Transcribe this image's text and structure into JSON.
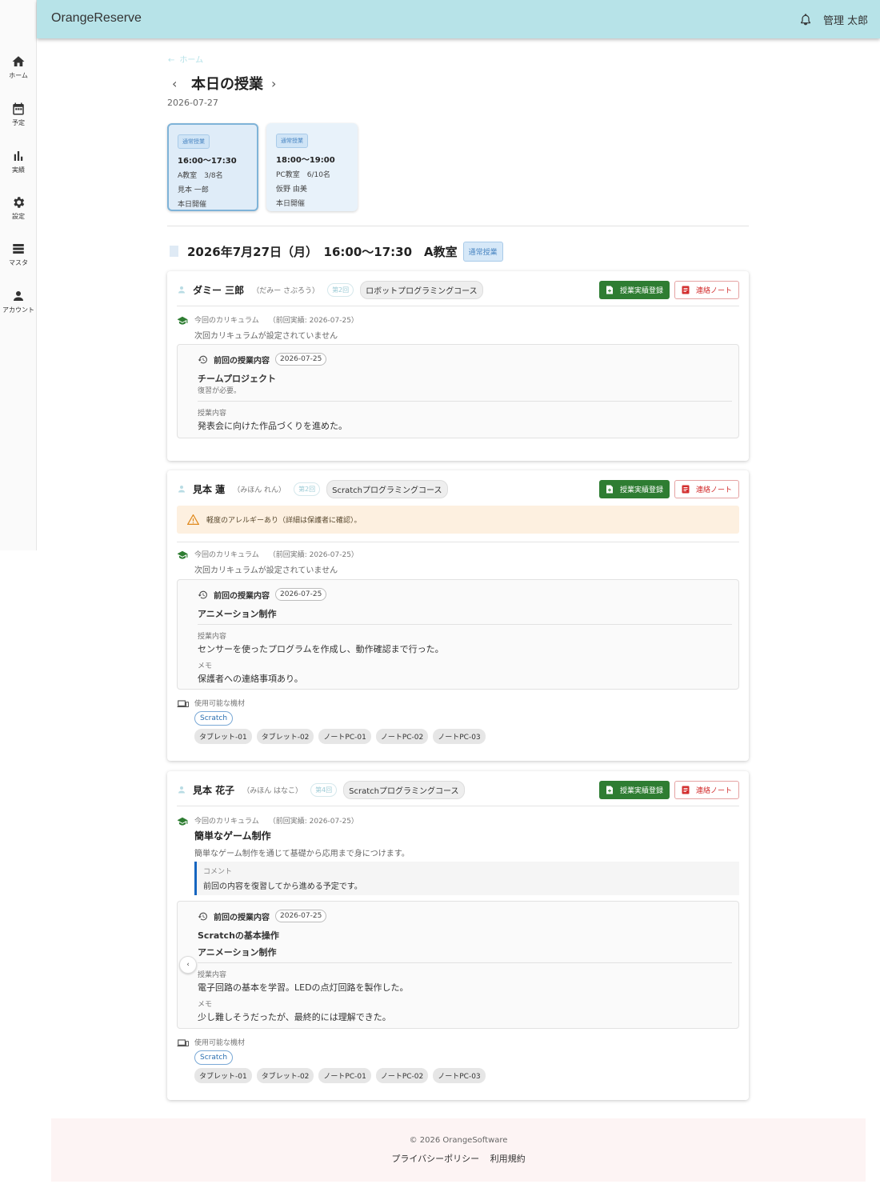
{
  "app": {
    "brand": "OrangeReserve",
    "user": "管理 太郎"
  },
  "sidebar": [
    {
      "label": "ホーム",
      "icon": "home-icon"
    },
    {
      "label": "予定",
      "icon": "calendar-icon"
    },
    {
      "label": "実績",
      "icon": "bar-chart-icon"
    },
    {
      "label": "設定",
      "icon": "gear-icon"
    },
    {
      "label": "マスタ",
      "icon": "list-icon"
    },
    {
      "label": "アカウント",
      "icon": "person-icon"
    }
  ],
  "page": {
    "breadcrumb": "ホーム",
    "title": "本日の授業",
    "date": "2026-07-27"
  },
  "class_cards": [
    {
      "tag": "通常授業",
      "time": "16:00〜17:30",
      "room_cap": "A教室　3/8名",
      "teacher": "見本 一郎",
      "status": "本日開催",
      "selected": true
    },
    {
      "tag": "通常授業",
      "time": "18:00〜19:00",
      "room_cap": "PC教室　6/10名",
      "teacher": "仮野 由美",
      "status": "本日開催",
      "selected": false
    }
  ],
  "section": {
    "heading": "2026年7月27日（月）　16:00〜17:30　A教室",
    "tag": "通常授業"
  },
  "labels": {
    "record_btn": "授業実績登録",
    "note_btn": "連絡ノート",
    "curriculum": "今回のカリキュラム",
    "prev_record": "（前回実績: 2026-07-25）",
    "no_curriculum": "次回カリキュラムが設定されていません",
    "prev_content": "前回の授業内容",
    "lesson_content": "授業内容",
    "memo": "メモ",
    "equipment": "使用可能な機材",
    "comment": "コメント"
  },
  "students": [
    {
      "name": "ダミー 三郎",
      "kana": "（だみー さぶろう）",
      "count": "第2回",
      "course": "ロボットプログラミングコース",
      "prev_date": "2026-07-25",
      "prev_title": "チームプロジェクト",
      "prev_note": "復習が必要。",
      "content": "発表会に向けた作品づくりを進めた。"
    },
    {
      "name": "見本 蓮",
      "kana": "（みほん れん）",
      "count": "第2回",
      "course": "Scratchプログラミングコース",
      "alert": "軽度のアレルギーあり（詳細は保護者に確認）。",
      "prev_date": "2026-07-25",
      "prev_title": "アニメーション制作",
      "content": "センサーを使ったプログラムを作成し、動作確認まで行った。",
      "memo": "保護者への連絡事項あり。",
      "equip_tag": "Scratch",
      "devices": [
        "タブレット-01",
        "タブレット-02",
        "ノートPC-01",
        "ノートPC-02",
        "ノートPC-03"
      ]
    },
    {
      "name": "見本 花子",
      "kana": "（みほん はなこ）",
      "count": "第4回",
      "course": "Scratchプログラミングコース",
      "cur_title": "簡単なゲーム制作",
      "cur_desc": "簡単なゲーム制作を通じて基礎から応用まで身につけます。",
      "comment": "前回の内容を復習してから進める予定です。",
      "prev_date": "2026-07-25",
      "prev_title1": "Scratchの基本操作",
      "prev_title2": "アニメーション制作",
      "content": "電子回路の基本を学習。LEDの点灯回路を製作した。",
      "memo": "少し難しそうだったが、最終的には理解できた。",
      "equip_tag": "Scratch",
      "devices": [
        "タブレット-01",
        "タブレット-02",
        "ノートPC-01",
        "ノートPC-02",
        "ノートPC-03"
      ]
    }
  ],
  "footer": {
    "copyright": "© 2026 OrangeSoftware",
    "privacy": "プライバシーポリシー",
    "terms": "利用規約"
  }
}
